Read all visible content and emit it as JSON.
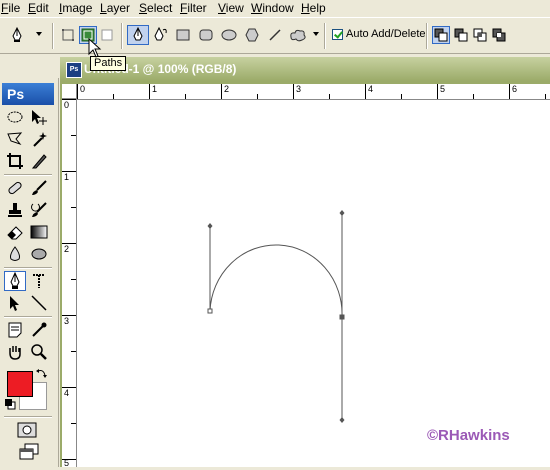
{
  "menu": [
    "File",
    "Edit",
    "Image",
    "Layer",
    "Select",
    "Filter",
    "View",
    "Window",
    "Help"
  ],
  "options": {
    "auto_add_delete_label": "Auto Add/Delete",
    "auto_add_delete_checked": true,
    "tooltip": "Paths"
  },
  "document": {
    "logo": "Ps",
    "title": "Untitled-1 @ 100% (RGB/8)"
  },
  "rulers": {
    "horizontal": [
      "0",
      "1",
      "2",
      "3",
      "4",
      "5",
      "6"
    ],
    "vertical": [
      "0",
      "1",
      "2",
      "3",
      "4",
      "5"
    ]
  },
  "toolbox": {
    "logo": "Ps",
    "foreground_color": "#ED1C24",
    "background_color": "#FFFFFF"
  },
  "watermark": "©RHawkins"
}
